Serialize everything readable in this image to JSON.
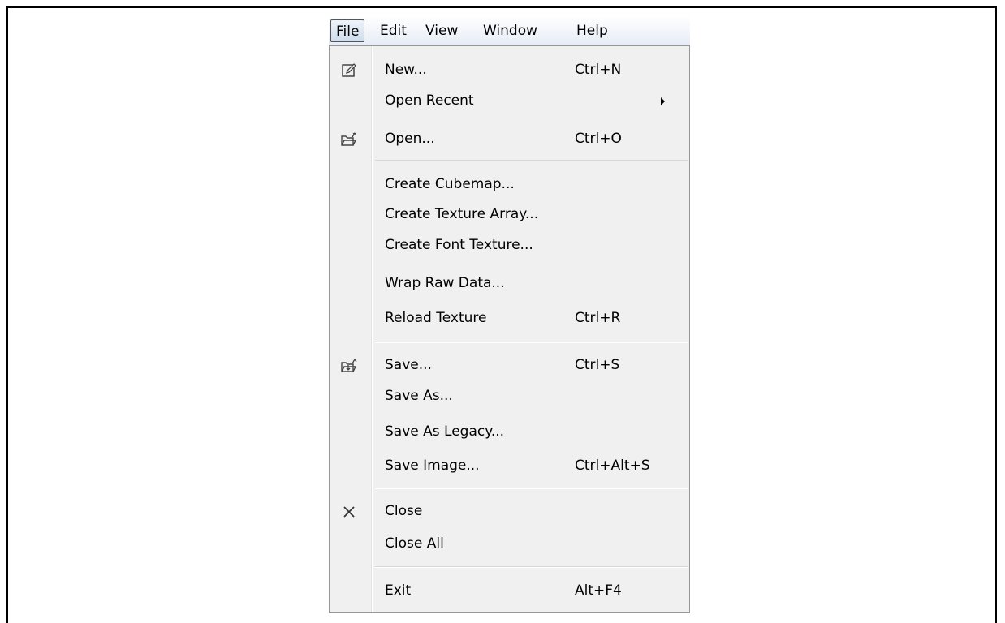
{
  "menubar": {
    "items": [
      "File",
      "Edit",
      "View",
      "Window",
      "Help"
    ]
  },
  "file_menu": {
    "new": {
      "label": "New...",
      "shortcut": "Ctrl+N",
      "icon": "new-document-icon"
    },
    "open_recent": {
      "label": "Open Recent",
      "submenu": true
    },
    "open": {
      "label": "Open...",
      "shortcut": "Ctrl+O",
      "icon": "open-folder-icon"
    },
    "create_cubemap": {
      "label": "Create Cubemap..."
    },
    "create_texture_array": {
      "label": "Create Texture Array..."
    },
    "create_font_texture": {
      "label": "Create Font Texture..."
    },
    "wrap_raw_data": {
      "label": "Wrap Raw Data..."
    },
    "reload_texture": {
      "label": "Reload Texture",
      "shortcut": "Ctrl+R"
    },
    "save": {
      "label": "Save...",
      "shortcut": "Ctrl+S",
      "icon": "save-folder-icon"
    },
    "save_as": {
      "label": "Save As..."
    },
    "save_as_legacy": {
      "label": "Save As Legacy..."
    },
    "save_image": {
      "label": "Save Image...",
      "shortcut": "Ctrl+Alt+S"
    },
    "close": {
      "label": "Close",
      "icon": "close-x-icon"
    },
    "close_all": {
      "label": "Close All"
    },
    "exit": {
      "label": "Exit",
      "shortcut": "Alt+F4"
    }
  },
  "colors": {
    "menu_background": "#f0f0f0",
    "menubar_gradient_bottom": "#e6ecf6",
    "separator": "#d7d7d7"
  }
}
